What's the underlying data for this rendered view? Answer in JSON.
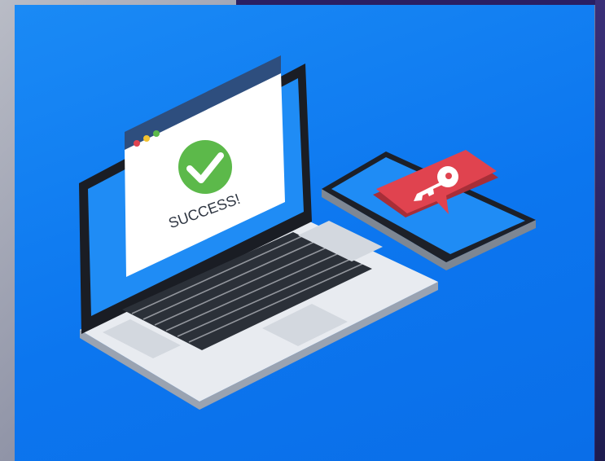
{
  "illustration": {
    "success_text": "SUCCESS!",
    "icons": {
      "check": "check-mark-icon",
      "key": "key-icon"
    },
    "colors": {
      "background": "#0c7af0",
      "success_green": "#5cb94a",
      "key_badge_red": "#e0434f",
      "browser_bar": "#2e4e7e",
      "laptop_body": "#e6e9ee",
      "screen_blue": "#1f8cf5"
    }
  }
}
